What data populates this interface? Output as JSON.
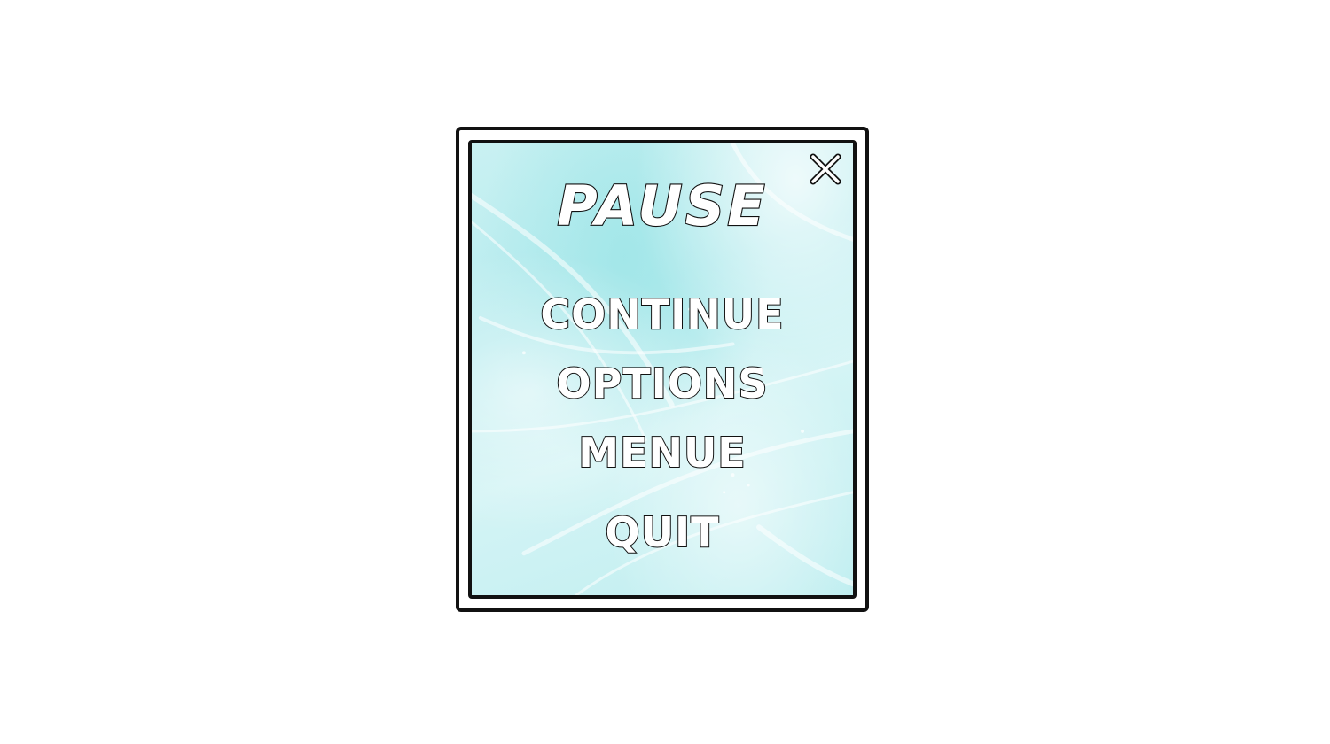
{
  "dialog": {
    "title": "PAUSE",
    "close_icon": "close-icon",
    "menu": [
      {
        "label": "CONTINUE"
      },
      {
        "label": "OPTIONS"
      },
      {
        "label": "MENUE"
      },
      {
        "label": "QUIT"
      }
    ]
  },
  "colors": {
    "page_background": "#ffffff",
    "panel_tint": "#c9f1f2",
    "outline": "#111111",
    "text_fill": "#ffffff"
  }
}
